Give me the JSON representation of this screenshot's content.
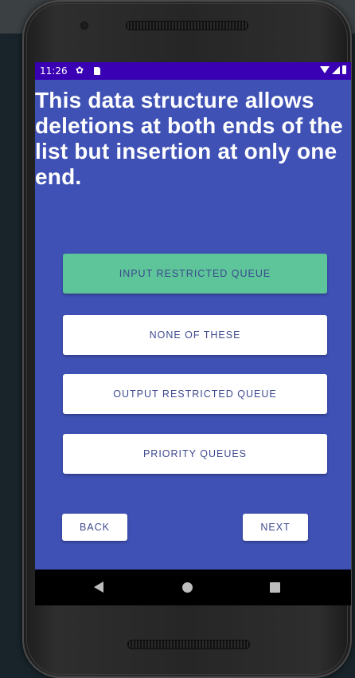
{
  "status_bar": {
    "time": "11:26"
  },
  "question": {
    "text": "This data structure allows deletions at both ends of the list but insertion at only one end."
  },
  "options": [
    {
      "label": "INPUT RESTRICTED QUEUE",
      "selected": true
    },
    {
      "label": "NONE OF THESE",
      "selected": false
    },
    {
      "label": "OUTPUT RESTRICTED QUEUE",
      "selected": false
    },
    {
      "label": "PRIORITY QUEUES",
      "selected": false
    }
  ],
  "navigation": {
    "back_label": "BACK",
    "next_label": "NEXT"
  },
  "colors": {
    "screen_background": "#3f51b5",
    "status_bar": "#3a00b4",
    "selected_option": "#5ec499",
    "button_text": "#3f4a8f"
  },
  "icons": {
    "status_left": [
      "settings-gear-icon",
      "sd-card-icon"
    ],
    "status_right": [
      "wifi-icon",
      "cell-signal-icon",
      "battery-icon"
    ],
    "system_nav": [
      "back-triangle-icon",
      "home-circle-icon",
      "recents-square-icon"
    ]
  }
}
